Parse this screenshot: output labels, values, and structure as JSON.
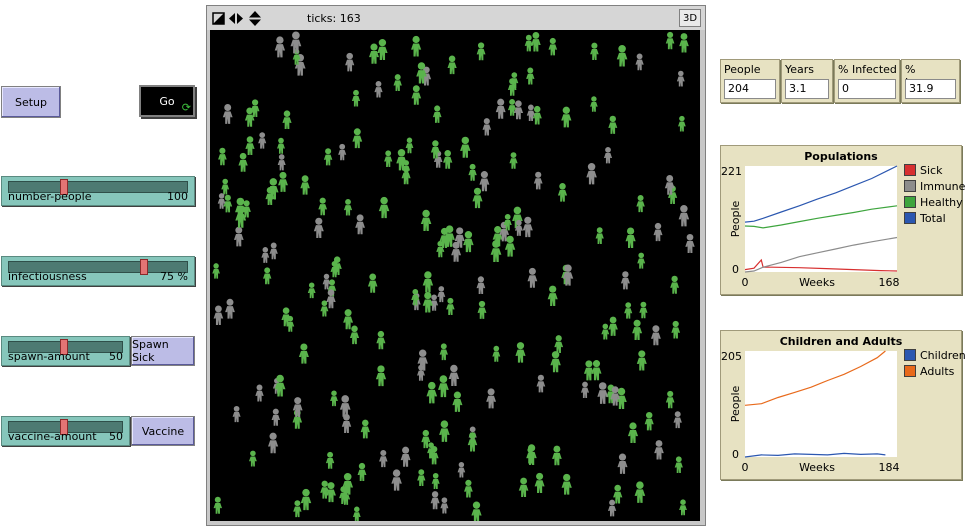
{
  "controls": {
    "setup_label": "Setup",
    "go_label": "Go",
    "sliders": [
      {
        "name": "number-people",
        "value": "100",
        "fraction": 0.34
      },
      {
        "name": "infectiousness",
        "value": "75 %",
        "fraction": 0.75
      },
      {
        "name": "spawn-amount",
        "value": "50",
        "fraction": 0.5
      },
      {
        "name": "vaccine-amount",
        "value": "50",
        "fraction": 0.5
      }
    ],
    "spawn_sick_label": "Spawn Sick",
    "vaccine_label": "Vaccine"
  },
  "view": {
    "ticks_label": "ticks: 163",
    "three_d_label": "3D"
  },
  "monitors": [
    {
      "label": "People",
      "value": "204"
    },
    {
      "label": "Years",
      "value": "3.1"
    },
    {
      "label": "% Infected",
      "value": "0"
    },
    {
      "label": "% Immune",
      "value": "31.9"
    }
  ],
  "colors": {
    "sick": "#d73030",
    "immune": "#8c8c8c",
    "healthy": "#3ea53e",
    "total": "#2b57b0",
    "children": "#2b57b0",
    "adults": "#e86a1c",
    "person_green": "#5ab44c",
    "person_gray": "#8d8d8d"
  },
  "chart_data": [
    {
      "type": "line",
      "title": "Populations",
      "xlabel": "Weeks",
      "ylabel": "People",
      "xlim": [
        0,
        168
      ],
      "ylim": [
        0,
        221
      ],
      "x_tick_labels": [
        "0",
        "168"
      ],
      "y_tick_labels": [
        "0",
        "221"
      ],
      "legend": "right",
      "series": [
        {
          "name": "Sick",
          "color": "#d73030",
          "x": [
            0,
            10,
            18,
            20,
            30,
            60,
            90,
            120,
            150,
            168
          ],
          "y": [
            5,
            8,
            25,
            10,
            10,
            9,
            7,
            5,
            3,
            2
          ]
        },
        {
          "name": "Immune",
          "color": "#8c8c8c",
          "x": [
            0,
            10,
            20,
            40,
            60,
            80,
            100,
            120,
            140,
            168
          ],
          "y": [
            0,
            2,
            10,
            20,
            32,
            40,
            48,
            56,
            63,
            72
          ]
        },
        {
          "name": "Healthy",
          "color": "#3ea53e",
          "x": [
            0,
            10,
            20,
            40,
            60,
            80,
            100,
            120,
            140,
            168
          ],
          "y": [
            96,
            95,
            92,
            98,
            105,
            112,
            118,
            124,
            131,
            138
          ]
        },
        {
          "name": "Total",
          "color": "#2b57b0",
          "x": [
            0,
            10,
            20,
            40,
            60,
            80,
            100,
            120,
            140,
            168
          ],
          "y": [
            104,
            106,
            112,
            125,
            138,
            152,
            165,
            180,
            195,
            221
          ]
        }
      ]
    },
    {
      "type": "line",
      "title": "Children and Adults",
      "xlabel": "Weeks",
      "ylabel": "People",
      "xlim": [
        0,
        184
      ],
      "ylim": [
        0,
        205
      ],
      "x_tick_labels": [
        "0",
        "184"
      ],
      "y_tick_labels": [
        "0",
        "205"
      ],
      "legend": "right",
      "series": [
        {
          "name": "Children",
          "color": "#2b57b0",
          "x": [
            0,
            20,
            40,
            60,
            80,
            100,
            120,
            140,
            160,
            170
          ],
          "y": [
            0,
            4,
            3,
            6,
            5,
            4,
            7,
            5,
            6,
            4
          ]
        },
        {
          "name": "Adults",
          "color": "#e86a1c",
          "x": [
            0,
            20,
            40,
            60,
            80,
            100,
            120,
            140,
            160,
            170
          ],
          "y": [
            100,
            103,
            115,
            125,
            135,
            148,
            160,
            175,
            192,
            205
          ]
        }
      ]
    }
  ]
}
